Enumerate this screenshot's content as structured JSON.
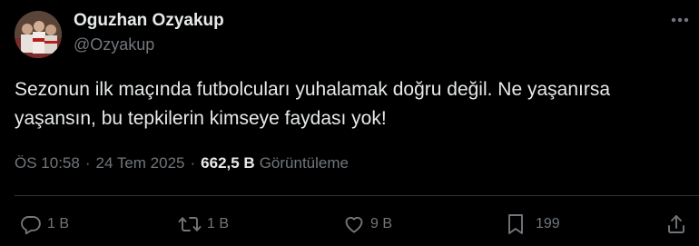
{
  "author": {
    "display_name": "Oguzhan Ozyakup",
    "handle": "@Ozyakup",
    "avatar": "profile-photo"
  },
  "tweet": {
    "text": "Sezonun ilk maçında futbolcuları yuhalamak doğru değil. Ne yaşanırsa\nyaşansın, bu tepkilerin kimseye faydası yok!"
  },
  "meta": {
    "time": "ÖS 10:58",
    "separator": "·",
    "date": "24 Tem 2025",
    "views_count": "662,5 B",
    "views_label": "Görüntüleme"
  },
  "actions": {
    "reply": {
      "icon": "reply-icon",
      "count": "1 B"
    },
    "retweet": {
      "icon": "retweet-icon",
      "count": "1 B"
    },
    "like": {
      "icon": "heart-icon",
      "count": "9 B"
    },
    "bookmark": {
      "icon": "bookmark-icon",
      "count": "199"
    },
    "share": {
      "icon": "share-icon"
    }
  },
  "colors": {
    "background": "#000000",
    "primary_text": "#e7e9ea",
    "secondary_text": "#71767b",
    "divider": "#2f3336"
  }
}
